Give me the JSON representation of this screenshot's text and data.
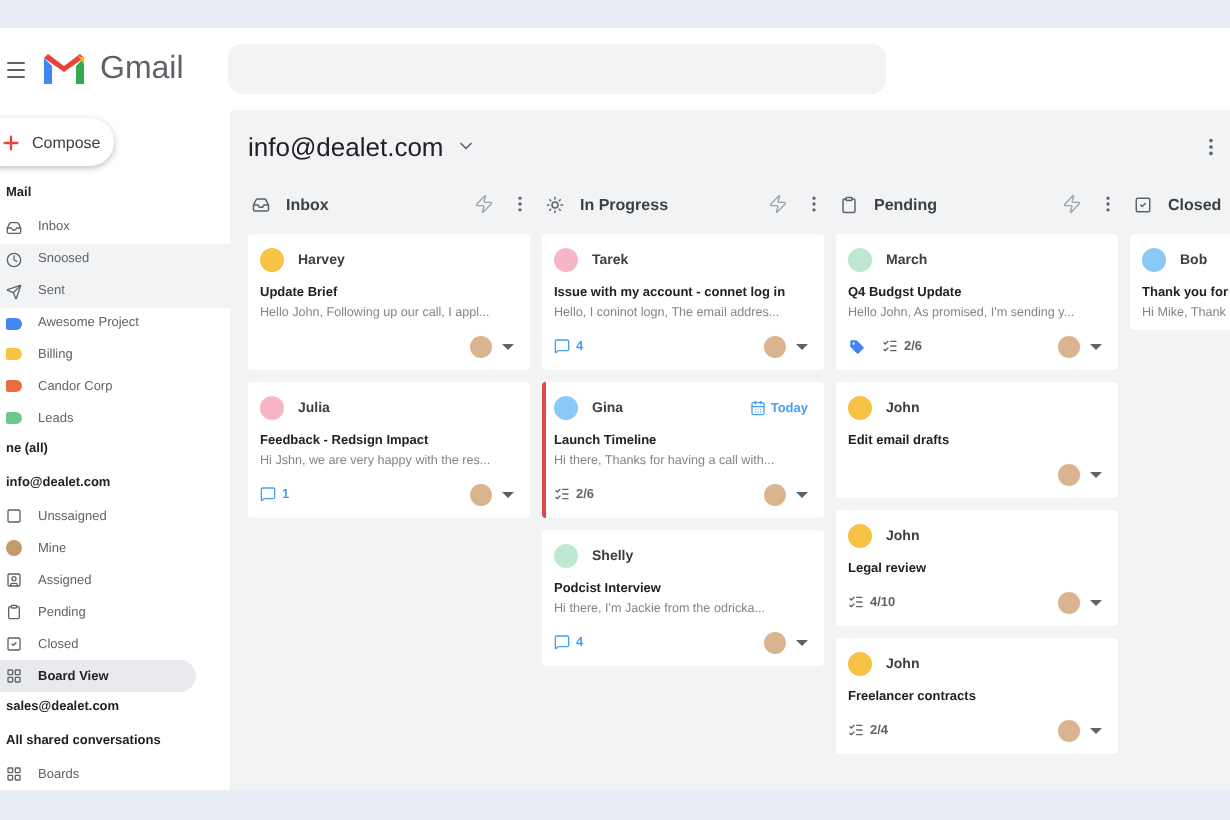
{
  "header": {
    "app_name": "Gmail"
  },
  "sidebar": {
    "compose": "Compose",
    "items": [
      {
        "kind": "heading",
        "text": "Mail"
      },
      {
        "kind": "nav",
        "text": "Inbox",
        "selected": false,
        "highlighted": false
      },
      {
        "kind": "nav",
        "text": "Snoosed",
        "selected": false,
        "highlighted": true
      },
      {
        "kind": "nav",
        "text": "Sent",
        "selected": false,
        "highlighted": true
      },
      {
        "kind": "label",
        "text": "Awesome Project",
        "color": "#4285f4",
        "selected": false,
        "highlighted": false
      },
      {
        "kind": "label",
        "text": "Billing",
        "color": "#f6c344",
        "selected": false,
        "highlighted": false
      },
      {
        "kind": "label",
        "text": "Candor Corp",
        "color": "#ea6b3f",
        "selected": false,
        "highlighted": false
      },
      {
        "kind": "label",
        "text": "Leads",
        "color": "#6cc98a",
        "selected": false,
        "highlighted": false
      },
      {
        "kind": "heading",
        "text": "ne (all)"
      },
      {
        "kind": "heading",
        "text": "info@dealet.com"
      },
      {
        "kind": "nav",
        "text": "Unssaigned",
        "selected": false,
        "highlighted": false
      },
      {
        "kind": "nav",
        "text": "Mine",
        "selected": false,
        "highlighted": false
      },
      {
        "kind": "nav",
        "text": "Assigned",
        "selected": false,
        "highlighted": false
      },
      {
        "kind": "nav",
        "text": "Pending",
        "selected": false,
        "highlighted": false
      },
      {
        "kind": "nav",
        "text": "Closed",
        "selected": false,
        "highlighted": false
      },
      {
        "kind": "nav",
        "text": "Board View",
        "selected": true,
        "highlighted": false
      },
      {
        "kind": "heading",
        "text": "sales@dealet.com"
      },
      {
        "kind": "heading",
        "text": "All shared conversations"
      },
      {
        "kind": "nav",
        "text": "Boards",
        "selected": false,
        "highlighted": false
      }
    ]
  },
  "board": {
    "title": "info@dealet.com",
    "columns": [
      {
        "title": "Inbox",
        "cards": [
          {
            "sender": "Harvey",
            "color": "#f6c344",
            "subject": "Update Brief",
            "preview": "Hello John, Following up our call, I appl...",
            "flagged": false,
            "assigned": true
          },
          {
            "sender": "Julia",
            "color": "#f7b6c8",
            "subject": "Feedback - Redsign Impact",
            "preview": "Hi Jshn, we are very happy with the res...",
            "flagged": false,
            "assigned": true,
            "meta": [
              {
                "kind": "comments",
                "count": "1"
              }
            ]
          }
        ]
      },
      {
        "title": "In Progress",
        "cards": [
          {
            "sender": "Tarek",
            "color": "#f7b6c8",
            "subject": "Issue with my account - connet log in",
            "preview": "Hello, I coninot logn, The email addres...",
            "flagged": false,
            "assigned": true,
            "meta": [
              {
                "kind": "comments",
                "count": "4"
              }
            ]
          },
          {
            "sender": "Gina",
            "color": "#8cc8f5",
            "badge": "Today",
            "subject": "Launch Timeline",
            "preview": "Hi there, Thanks for having a call with...",
            "flagged": true,
            "assigned": true,
            "meta": [
              {
                "kind": "checklist",
                "count": "2/6"
              }
            ]
          },
          {
            "sender": "Shelly",
            "color": "#bfe8d0",
            "subject": "Podcist Interview",
            "preview": "Hi there, I'm Jackie from the odricka...",
            "flagged": false,
            "assigned": true,
            "meta": [
              {
                "kind": "comments",
                "count": "4"
              }
            ]
          }
        ]
      },
      {
        "title": "Pending",
        "cards": [
          {
            "sender": "March",
            "color": "#bfe8d0",
            "subject": "Q4 Budgst Update",
            "preview": "Hello John, As promised, I'm sending y...",
            "flagged": false,
            "assigned": true,
            "meta": [
              {
                "kind": "tag"
              },
              {
                "kind": "checklist",
                "count": "2/6"
              }
            ]
          },
          {
            "sender": "John",
            "color": "#f6c344",
            "subject": "Edit email drafts",
            "flagged": false,
            "assigned": true
          },
          {
            "sender": "John",
            "color": "#f6c344",
            "subject": "Legal review",
            "flagged": false,
            "assigned": true,
            "meta": [
              {
                "kind": "checklist",
                "count": "4/10"
              }
            ]
          },
          {
            "sender": "John",
            "color": "#f6c344",
            "subject": "Freelancer contracts",
            "flagged": false,
            "assigned": true,
            "meta": [
              {
                "kind": "checklist",
                "count": "2/4"
              }
            ]
          }
        ]
      },
      {
        "title": "Closed",
        "cards": [
          {
            "sender": "Bob",
            "color": "#8cc8f5",
            "subject": "Thank you for",
            "preview": "Hi Mike, Thank",
            "flagged": false,
            "assigned": false
          }
        ]
      }
    ]
  }
}
